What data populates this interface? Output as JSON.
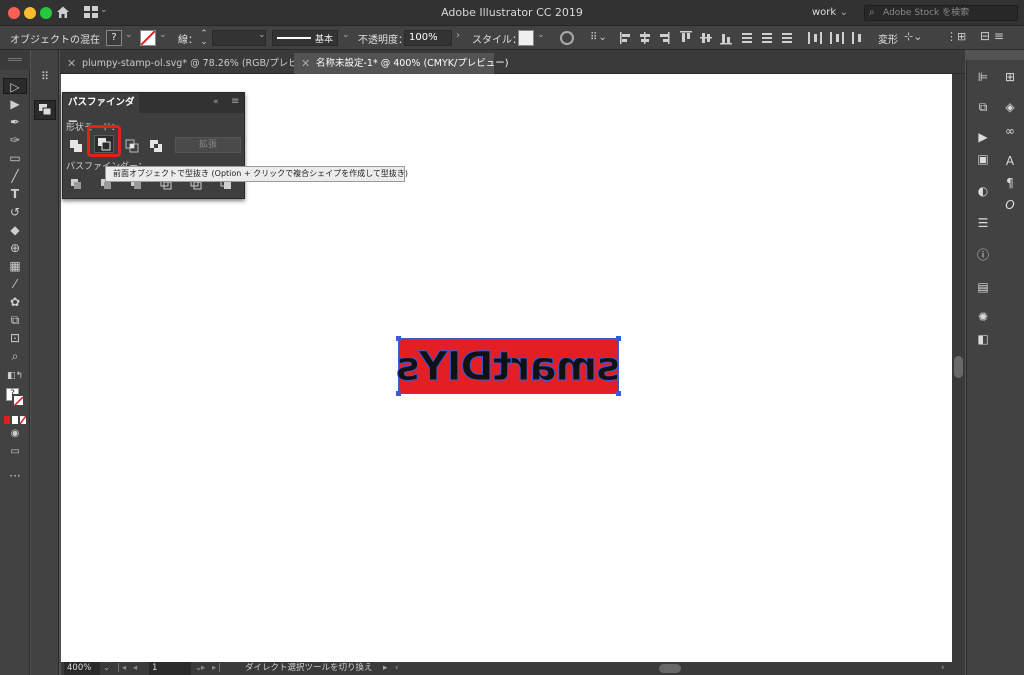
{
  "app": {
    "title": "Adobe Illustrator CC 2019"
  },
  "titlebar": {
    "workspace": "work",
    "search_placeholder": "Adobe Stock を検索"
  },
  "control": {
    "selection_label": "オブジェクトの混在",
    "stroke_label": "線：",
    "stroke_style": "基本",
    "opacity_label": "不透明度：",
    "opacity_value": "100%",
    "style_label": "スタイル：",
    "transform_label": "変形"
  },
  "tabs": [
    {
      "label": "plumpy-stamp-ol.svg* @ 78.26% (RGB/プレビュー)"
    },
    {
      "label": "名称未設定-1* @ 400% (CMYK/プレビュー)"
    }
  ],
  "pathfinder": {
    "title": "パスファインダー",
    "shape_modes_label": "形状モード：",
    "expand_label": "拡張",
    "pathfinders_label": "パスファインダー：",
    "tooltip": "前面オブジェクトで型抜き (Option + クリックで複合シェイプを作成して型抜き)"
  },
  "artwork": {
    "text": "smartDIYs",
    "fill_color": "#e31e24",
    "selection_color": "#3b5bd6"
  },
  "status": {
    "zoom": "400%",
    "artboard": "1",
    "message": "ダイレクト選択ツールを切り換え"
  }
}
